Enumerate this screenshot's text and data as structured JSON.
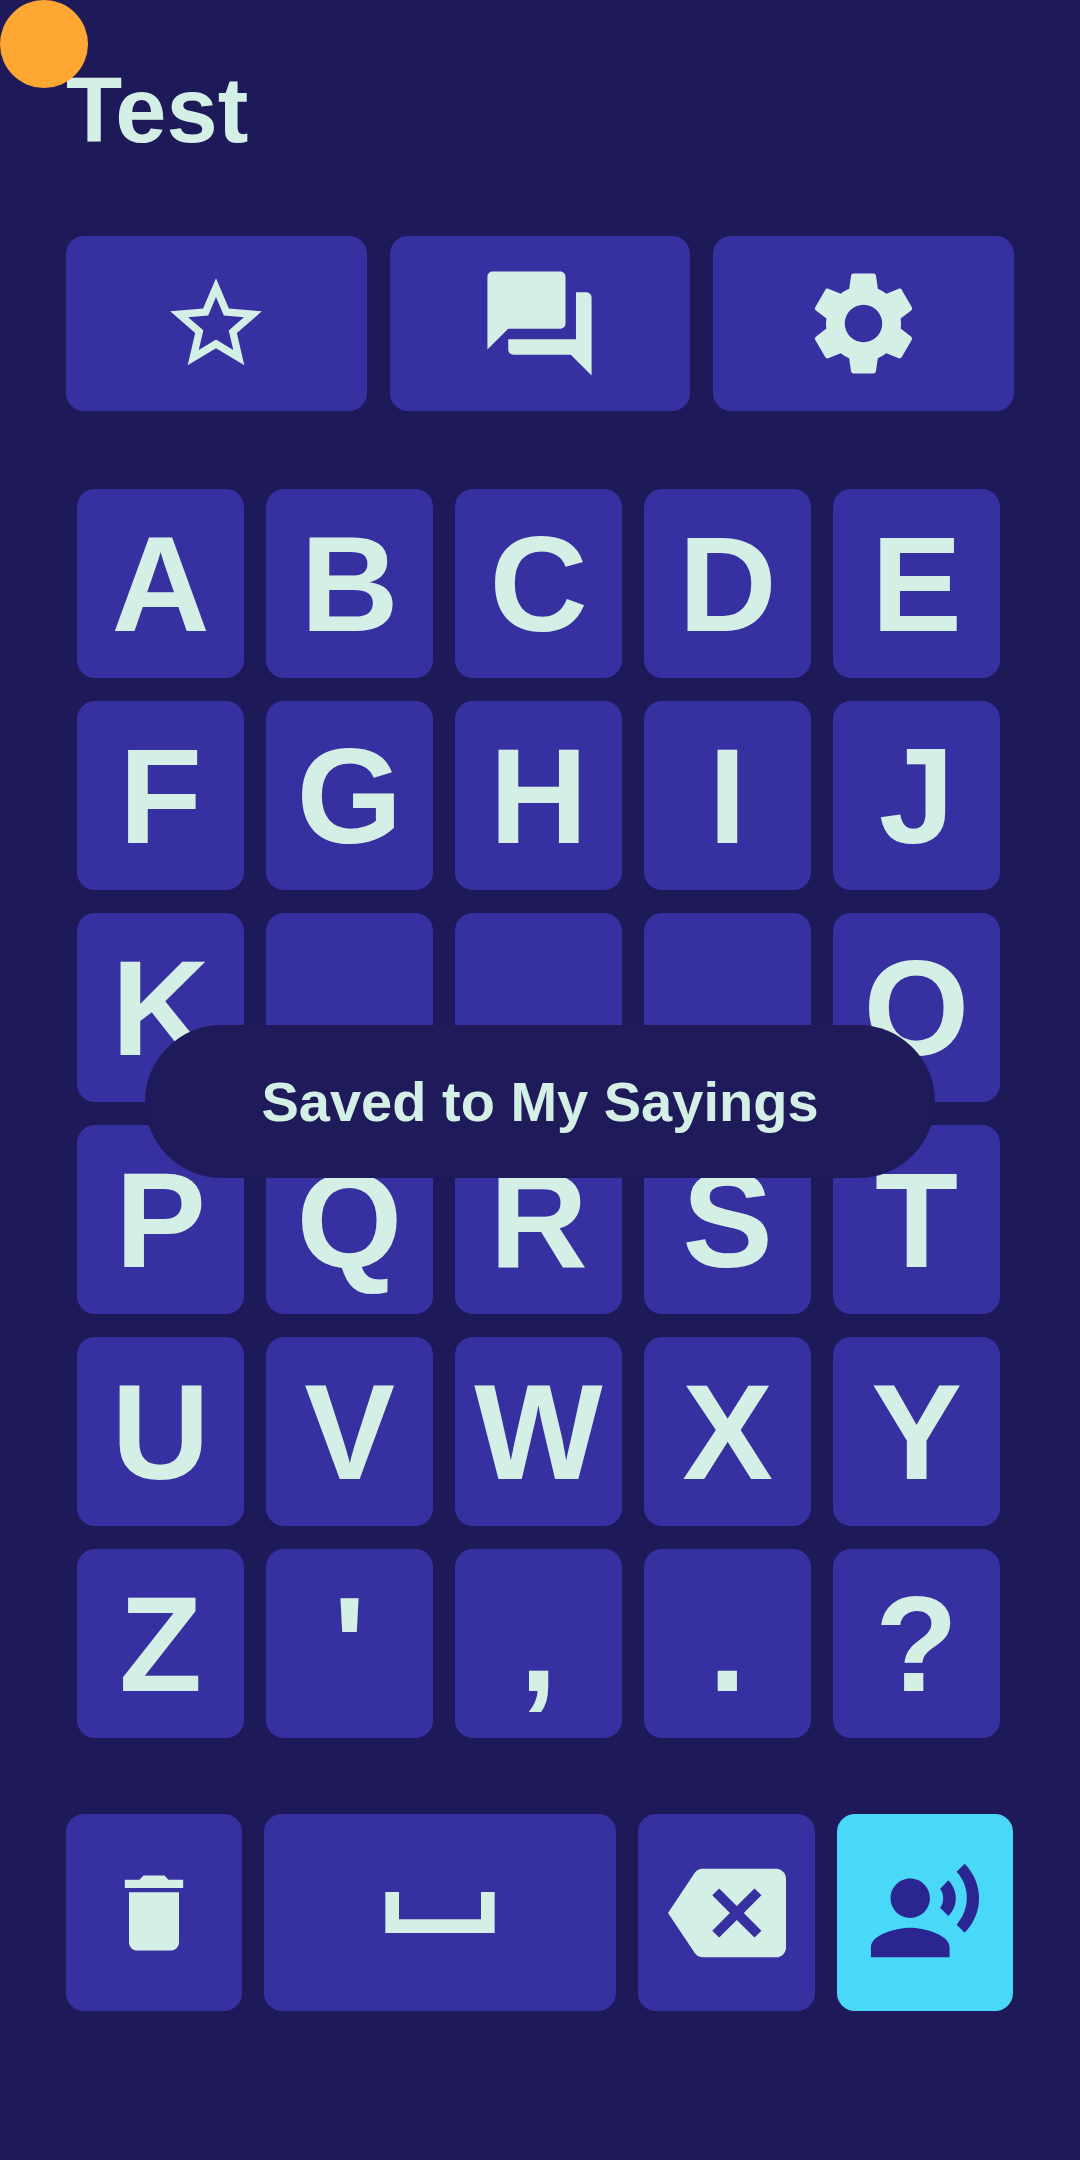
{
  "title": "Test",
  "keys": [
    {
      "label": "A"
    },
    {
      "label": "B"
    },
    {
      "label": "C"
    },
    {
      "label": "D"
    },
    {
      "label": "E"
    },
    {
      "label": "F"
    },
    {
      "label": "G"
    },
    {
      "label": "H"
    },
    {
      "label": "I"
    },
    {
      "label": "J"
    },
    {
      "label": "K"
    },
    {
      "covered": true
    },
    {
      "covered": true
    },
    {
      "covered": true
    },
    {
      "label": "O"
    },
    {
      "label": "P"
    },
    {
      "label": "Q"
    },
    {
      "label": "R"
    },
    {
      "label": "S"
    },
    {
      "label": "T"
    },
    {
      "label": "U"
    },
    {
      "label": "V"
    },
    {
      "label": "W"
    },
    {
      "label": "X"
    },
    {
      "label": "Y"
    },
    {
      "label": "Z"
    },
    {
      "label": "'"
    },
    {
      "label": ","
    },
    {
      "label": "."
    },
    {
      "label": "?"
    }
  ],
  "toast": {
    "text": "Saved to My Sayings"
  }
}
